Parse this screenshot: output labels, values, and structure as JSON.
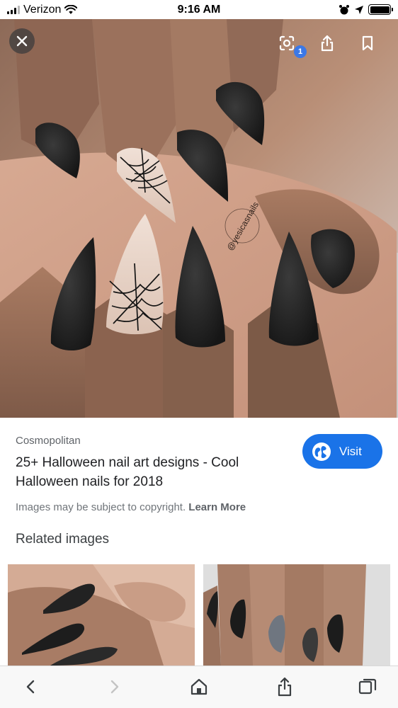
{
  "status_bar": {
    "carrier": "Verizon",
    "time": "9:16 AM",
    "icons": [
      "signal-icon",
      "wifi-icon",
      "alarm-icon",
      "location-icon",
      "battery-icon"
    ]
  },
  "image_viewer": {
    "watermark": "@yesicasnails",
    "lens_badge_count": "1",
    "buttons": [
      "close-icon",
      "lens-icon",
      "share-icon",
      "bookmark-icon"
    ]
  },
  "result": {
    "source": "Cosmopolitan",
    "title": "25+ Halloween nail art designs - Cool Halloween nails for 2018",
    "visit_label": "Visit",
    "copyright_text": "Images may be subject to copyright.",
    "learn_more_label": "Learn More"
  },
  "related": {
    "heading": "Related images"
  },
  "toolbar": {
    "icons": [
      "back-icon",
      "forward-icon",
      "home-icon",
      "share-icon",
      "tabs-icon"
    ]
  },
  "colors": {
    "accent": "#1a73e8",
    "badge": "#3b78e7",
    "nail_black": "#1f1f1f",
    "nail_nude": "#e8d3c6",
    "skin": "#b88a6e"
  }
}
